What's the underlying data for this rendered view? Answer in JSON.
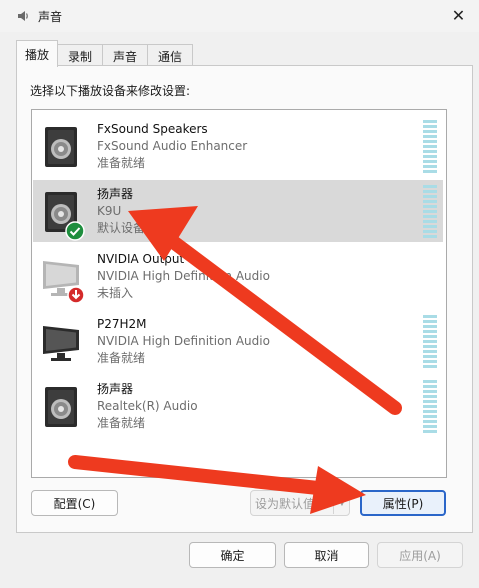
{
  "window": {
    "title": "声音",
    "close_glyph": "✕"
  },
  "tabs": [
    {
      "label": "播放",
      "active": true
    },
    {
      "label": "录制",
      "active": false
    },
    {
      "label": "声音",
      "active": false
    },
    {
      "label": "通信",
      "active": false
    }
  ],
  "instruction": "选择以下播放设备来修改设置:",
  "devices": [
    {
      "name": "FxSound Speakers",
      "desc": "FxSound Audio Enhancer",
      "status": "准备就绪",
      "icon": "speaker-icon",
      "selected": false
    },
    {
      "name": "扬声器",
      "desc": "K9U",
      "status": "默认设备",
      "icon": "speaker-icon",
      "badge": "default-check-icon",
      "selected": true
    },
    {
      "name": "NVIDIA Output",
      "desc": "NVIDIA High Definition Audio",
      "status": "未插入",
      "icon": "monitor-icon",
      "badge": "unplugged-icon",
      "selected": false
    },
    {
      "name": "P27H2M",
      "desc": "NVIDIA High Definition Audio",
      "status": "准备就绪",
      "icon": "monitor-icon",
      "selected": false
    },
    {
      "name": "扬声器",
      "desc": "Realtek(R) Audio",
      "status": "准备就绪",
      "icon": "speaker-icon",
      "selected": false
    }
  ],
  "buttons": {
    "configure": "配置(C)",
    "set_default": "设为默认值",
    "properties": "属性(P)",
    "ok": "确定",
    "cancel": "取消",
    "apply": "应用(A)"
  },
  "colors": {
    "annotation_arrow": "#ee3a1f",
    "accent_border": "#2a66c9",
    "check_badge": "#1e8e3e",
    "unplug_badge": "#d42a2a",
    "meter": "#a9dce6"
  }
}
